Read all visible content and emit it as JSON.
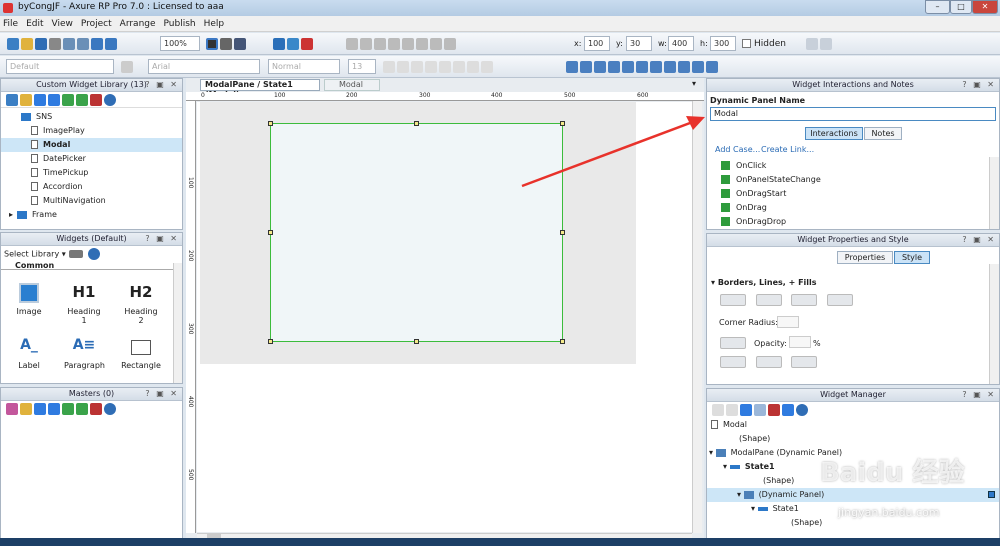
{
  "window": {
    "title": "byCongJF - Axure RP Pro 7.0 : Licensed to aaa",
    "btn_min": "–",
    "btn_max": "□",
    "btn_close": "✕"
  },
  "menu": [
    "File",
    "Edit",
    "View",
    "Project",
    "Arrange",
    "Publish",
    "Help"
  ],
  "toolbar": {
    "zoom": "100%",
    "x_label": "x:",
    "x": "100",
    "y_label": "y:",
    "y": "30",
    "w_label": "w:",
    "w": "400",
    "h_label": "h:",
    "h": "300",
    "hidden": "Hidden",
    "style": "Default",
    "font": "Arial",
    "weight": "Normal",
    "size": "13"
  },
  "left_panel": {
    "title": "Custom Widget Library (13)",
    "items": [
      "SNS",
      "ImagePlay",
      "Modal",
      "DatePicker",
      "TimePickup",
      "Accordion",
      "MultiNavigation",
      "Frame"
    ]
  },
  "widgets_panel": {
    "title": "Widgets (Default)",
    "select_library": "Select Library",
    "section": "Common",
    "items": [
      "Image",
      "Heading 1",
      "Heading 2",
      "Label",
      "Paragraph",
      "Rectangle"
    ],
    "h1": "H1",
    "h2": "H2"
  },
  "masters_panel": {
    "title": "Masters (0)"
  },
  "tabs": {
    "active": "ModalPane / State1 (Modal)",
    "other": "Modal"
  },
  "ruler": {
    "h": [
      "0",
      "100",
      "200",
      "300",
      "400",
      "500",
      "600"
    ],
    "v": [
      "100",
      "200",
      "300",
      "400",
      "500"
    ]
  },
  "interactions": {
    "title": "Widget Interactions and Notes",
    "label": "Dynamic Panel Name",
    "value": "Modal",
    "tab1": "Interactions",
    "tab2": "Notes",
    "add_case": "Add Case...",
    "create_link": "Create Link...",
    "events": [
      "OnClick",
      "OnPanelStateChange",
      "OnDragStart",
      "OnDrag",
      "OnDragDrop"
    ]
  },
  "properties": {
    "title": "Widget Properties and Style",
    "tab1": "Properties",
    "tab2": "Style",
    "section": "Borders, Lines, + Fills",
    "corner_radius": "Corner Radius:",
    "opacity": "Opacity:",
    "percent": "%"
  },
  "manager": {
    "title": "Widget Manager",
    "rows": [
      "Modal",
      "(Shape)",
      "ModalPane (Dynamic Panel)",
      "State1",
      "(Shape)",
      "(Dynamic Panel)",
      "State1",
      "(Shape)"
    ]
  },
  "watermark": {
    "text": "Baidu 经验",
    "url": "jingyan.baidu.com"
  }
}
